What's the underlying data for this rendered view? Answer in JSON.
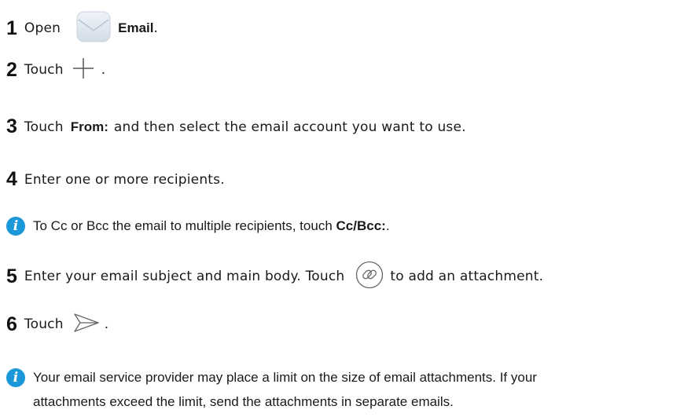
{
  "steps": {
    "s1": {
      "num": "1",
      "pre": "Open",
      "bold": "Email",
      "post": "."
    },
    "s2": {
      "num": "2",
      "pre": "Touch",
      "post": "."
    },
    "s3": {
      "num": "3",
      "pre": "Touch",
      "bold": "From:",
      "post": "and then select the email account you want to use."
    },
    "s4": {
      "num": "4",
      "text": "Enter one or more recipients."
    },
    "s5": {
      "num": "5",
      "pre": "Enter your email subject and main body. Touch",
      "post": "to add an attachment."
    },
    "s6": {
      "num": "6",
      "pre": "Touch",
      "post": "."
    }
  },
  "notes": {
    "n1": {
      "pre": "To Cc or Bcc the email to multiple recipients, touch",
      "bold": "Cc/Bcc:",
      "post": "."
    },
    "n2": {
      "line1": "Your email service provider may place a limit on the size of email attachments. If your",
      "line2": "attachments exceed the limit, send the attachments in separate emails."
    }
  },
  "icons": {
    "email": "email-app-icon",
    "add": "plus-icon",
    "attach": "attachment-icon",
    "send": "send-icon",
    "info": "info-icon"
  },
  "colors": {
    "info": "#1c97d8",
    "text": "#1a1a1a"
  }
}
